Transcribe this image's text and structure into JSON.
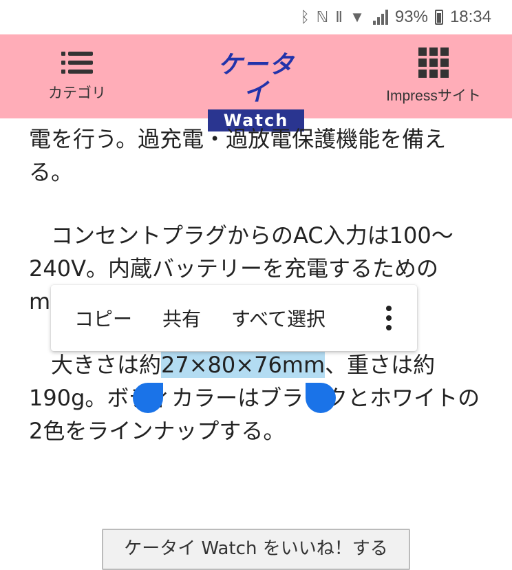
{
  "status_bar": {
    "battery_percent": "93%",
    "time": "18:34",
    "icons": [
      "bluetooth-icon",
      "nfc-icon",
      "vibrate-icon",
      "wifi-icon",
      "signal-icon",
      "battery-icon"
    ]
  },
  "header": {
    "left_label": "カテゴリ",
    "right_label": "Impressサイト",
    "logo_top": "ケータイ",
    "logo_bottom": "Watch",
    "background": "#ffadb8"
  },
  "article": {
    "p1": "電を行う。過充電・過放電保護機能を備える。",
    "p2": "コンセントプラグからのAC入力は100〜240V。内蔵バッテリーを充電するためのmicroUSB",
    "p3_before": "大きさは約",
    "p3_selected": "27×80×76mm",
    "p3_after": "、重さは約190g。ボディカラーはブラックとホワイトの2色をラインナップする。"
  },
  "context_menu": {
    "copy": "コピー",
    "share": "共有",
    "select_all": "すべて選択"
  },
  "bottom_button": {
    "label": "ケータイ Watch をいいね！する"
  },
  "colors": {
    "selection": "#b3dcf2",
    "handle": "#1a73e8",
    "logo_blue": "#2a3590"
  }
}
